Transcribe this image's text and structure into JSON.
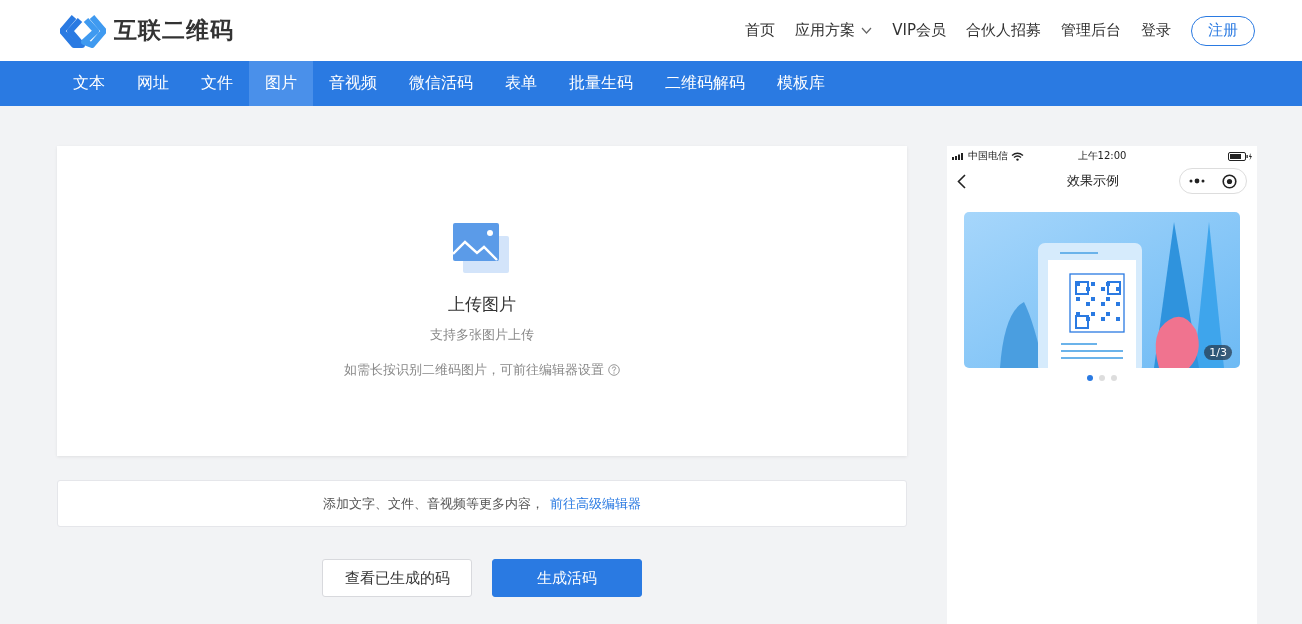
{
  "header": {
    "logo_text": "互联二维码",
    "nav": [
      {
        "label": "首页",
        "dropdown": false
      },
      {
        "label": "应用方案",
        "dropdown": true
      },
      {
        "label": "VIP会员",
        "dropdown": false
      },
      {
        "label": "合伙人招募",
        "dropdown": false
      },
      {
        "label": "管理后台",
        "dropdown": false
      },
      {
        "label": "登录",
        "dropdown": false
      }
    ],
    "register_button": "注册"
  },
  "tabs": [
    {
      "label": "文本",
      "selected": false
    },
    {
      "label": "网址",
      "selected": false
    },
    {
      "label": "文件",
      "selected": false
    },
    {
      "label": "图片",
      "selected": true
    },
    {
      "label": "音视频",
      "selected": false
    },
    {
      "label": "微信活码",
      "selected": false
    },
    {
      "label": "表单",
      "selected": false
    },
    {
      "label": "批量生码",
      "selected": false
    },
    {
      "label": "二维码解码",
      "selected": false
    },
    {
      "label": "模板库",
      "selected": false
    }
  ],
  "upload": {
    "title": "上传图片",
    "subtitle": "支持多张图片上传",
    "hint": "如需长按识别二维码图片，可前往编辑器设置"
  },
  "more_bar": {
    "text": "添加文字、文件、音视频等更多内容，",
    "link": "前往高级编辑器"
  },
  "buttons": [
    {
      "label": "查看已生成的码",
      "kind": "secondary"
    },
    {
      "label": "生成活码",
      "kind": "primary"
    }
  ],
  "preview": {
    "carrier": "中国电信",
    "time": "上午12:00",
    "title": "效果示例",
    "slide_counter": "1/3",
    "dots": [
      {
        "selected": true
      },
      {
        "selected": false
      },
      {
        "selected": false
      }
    ]
  }
}
